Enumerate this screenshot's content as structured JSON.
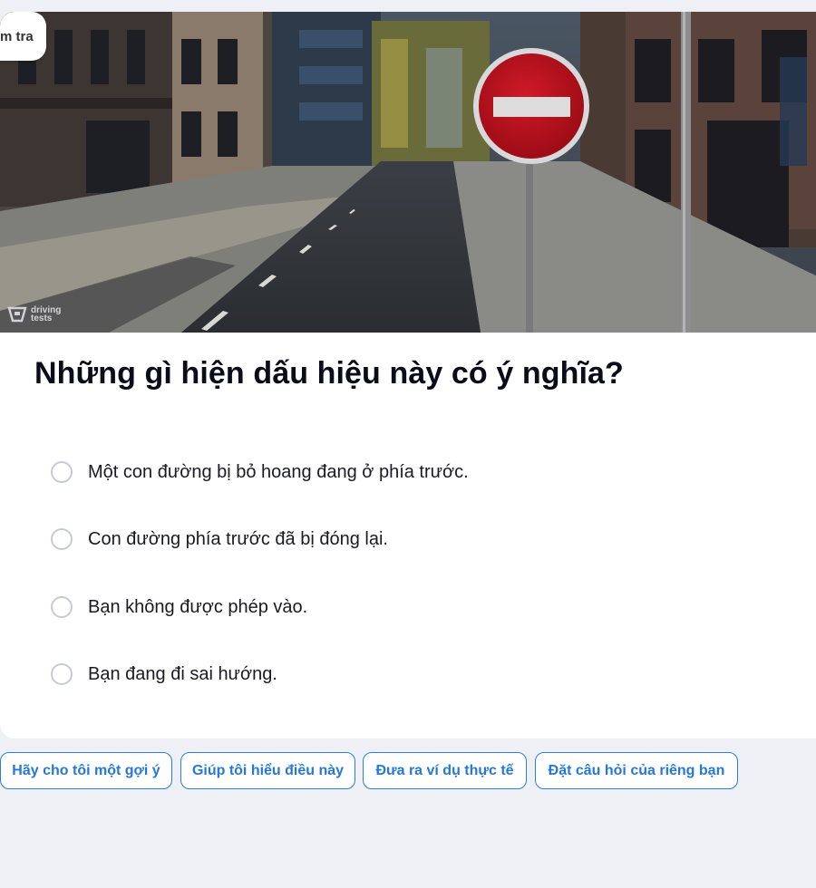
{
  "badge": {
    "label": "m tra"
  },
  "image": {
    "logo_line1": "driving",
    "logo_line2": "tests",
    "sign_color": "#c0121f",
    "sign_bar_color": "#dcdcdc"
  },
  "question": {
    "text": "Những gì hiện dấu hiệu này có ý nghĩa?"
  },
  "options": [
    {
      "label": "Một con đường bị bỏ hoang đang ở phía trước.",
      "selected": false
    },
    {
      "label": "Con đường phía trước đã bị đóng lại.",
      "selected": false
    },
    {
      "label": "Bạn không được phép vào.",
      "selected": false
    },
    {
      "label": "Bạn đang đi sai hướng.",
      "selected": false
    }
  ],
  "help_chips": [
    {
      "label": "Hãy cho tôi một gợi ý"
    },
    {
      "label": "Giúp tôi hiểu điều này"
    },
    {
      "label": "Đưa ra ví dụ thực tế"
    },
    {
      "label": "Đặt câu hỏi của riêng bạn"
    }
  ],
  "colors": {
    "accent": "#2578da",
    "background": "#eff0f6",
    "radio_border": "#c8c9d6"
  }
}
